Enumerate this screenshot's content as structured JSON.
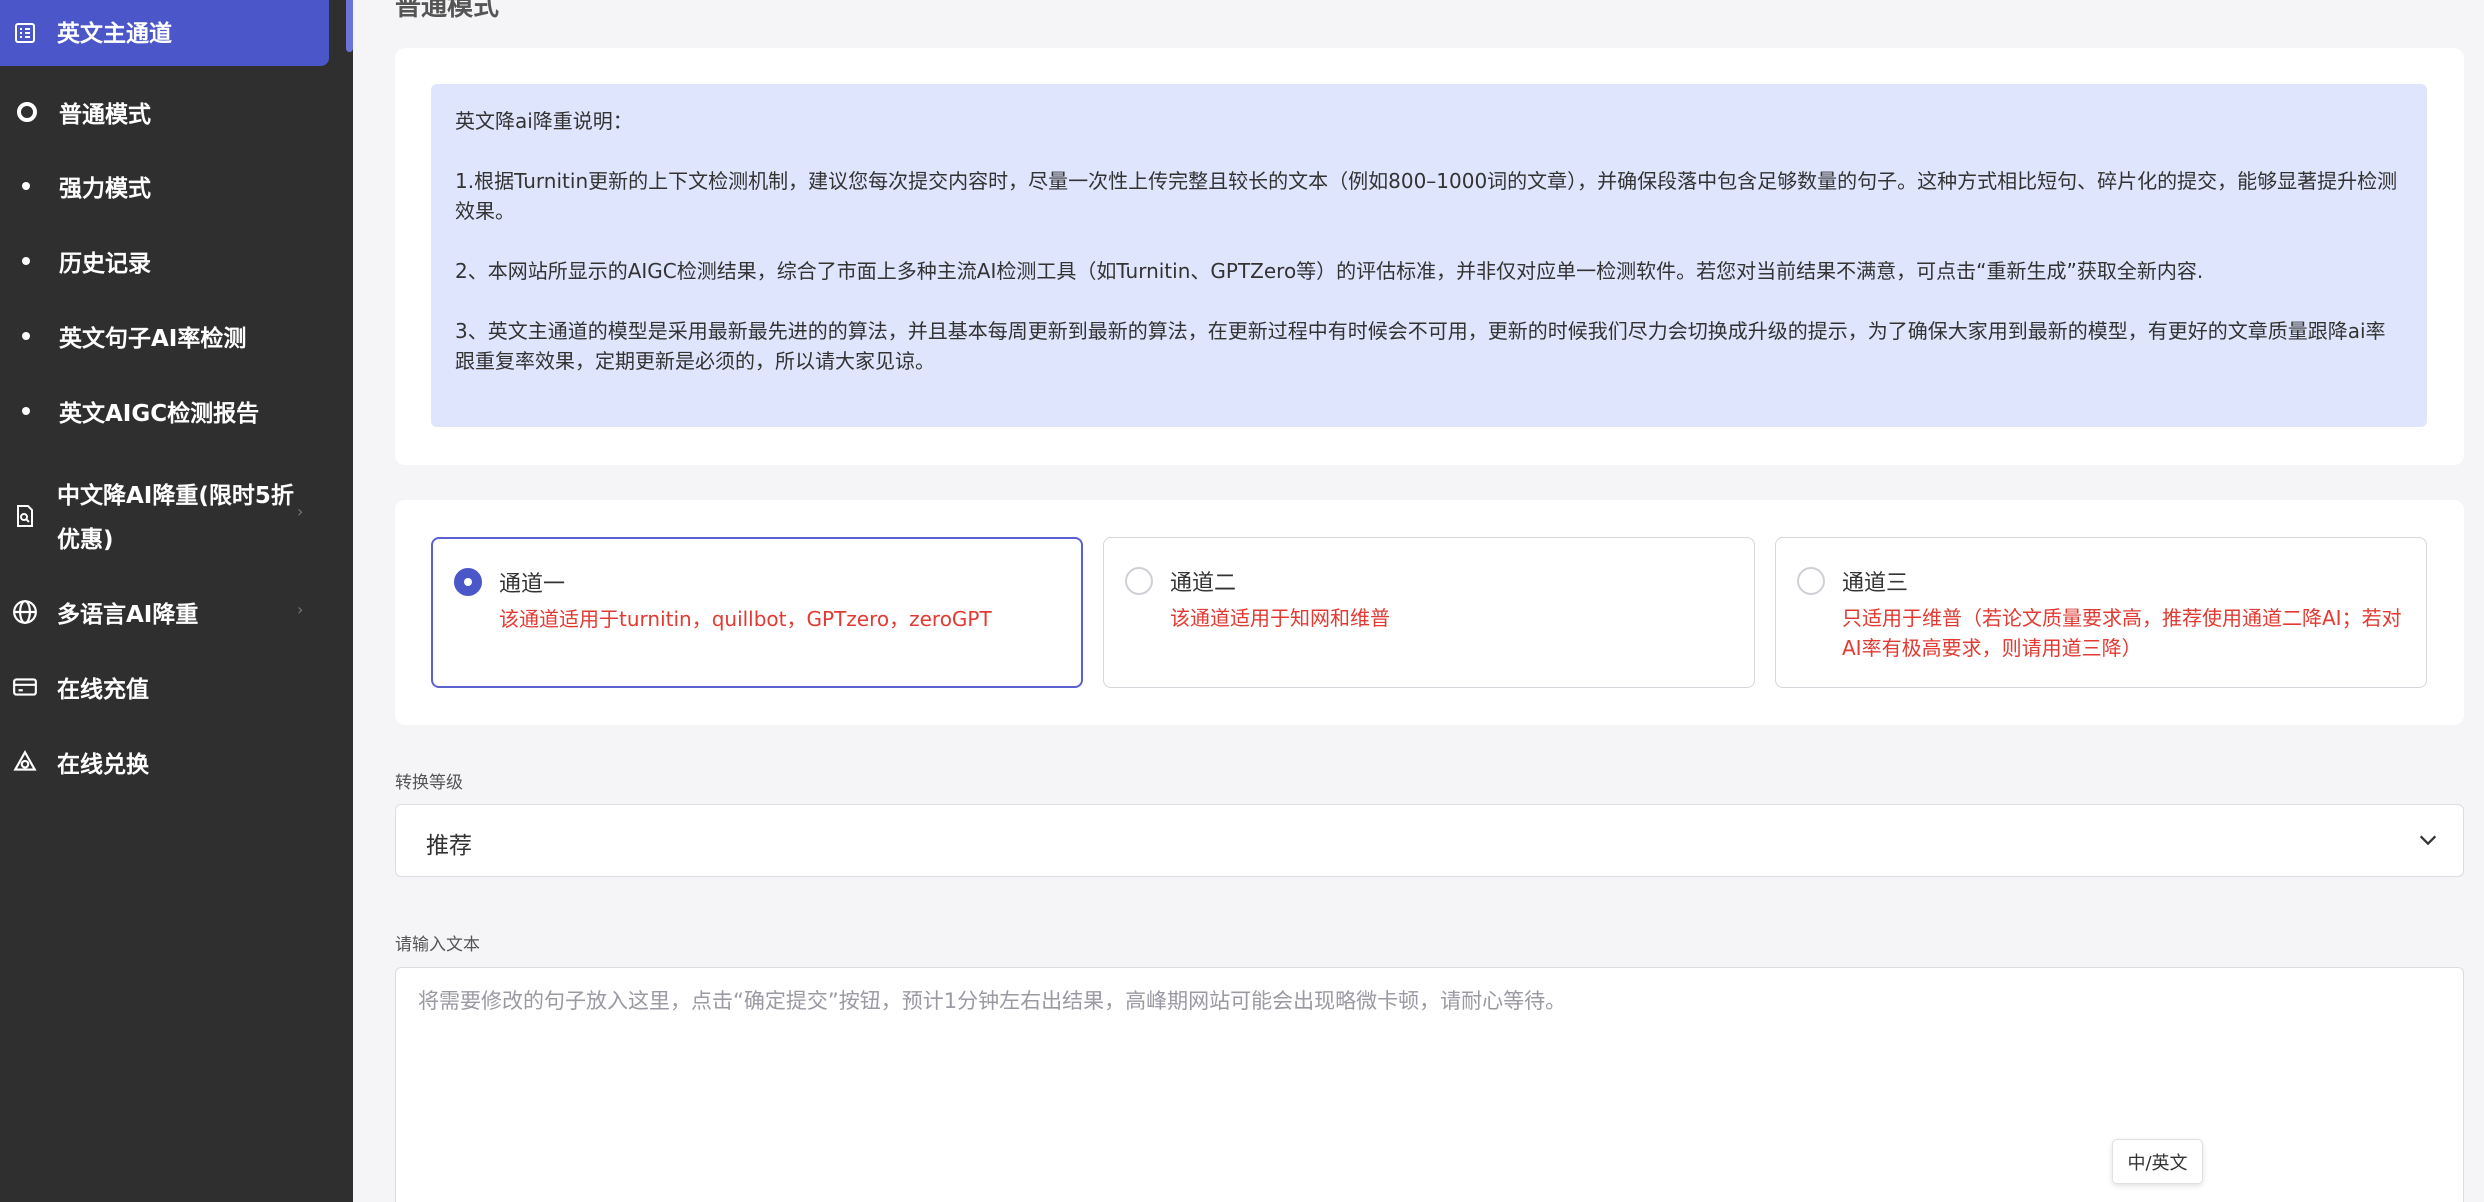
{
  "sidebar": {
    "active_item": {
      "label": "英文主通道",
      "icon": "document-list-icon"
    },
    "sub_items": [
      {
        "label": "普通模式",
        "icon": "ring-icon",
        "selected": true
      },
      {
        "label": "强力模式",
        "icon": "dot-icon"
      },
      {
        "label": "历史记录",
        "icon": "dot-icon"
      },
      {
        "label": "英文句子AI率检测",
        "icon": "dot-icon"
      },
      {
        "label": "英文AIGC检测报告",
        "icon": "dot-icon"
      }
    ],
    "items": [
      {
        "label_line1": "中文降AI降重(限时5折",
        "label_line2": "优惠)",
        "icon": "doc-search-icon",
        "has_chevron": true
      },
      {
        "label": "多语言AI降重",
        "icon": "globe-icon",
        "has_chevron": true
      },
      {
        "label": "在线充值",
        "icon": "card-icon"
      },
      {
        "label": "在线兑换",
        "icon": "exchange-icon"
      }
    ]
  },
  "page_title": "普通模式",
  "notice": {
    "heading": "英文降ai降重说明：",
    "para1": "1.根据Turnitin更新的上下文检测机制，建议您每次提交内容时，尽量一次性上传完整且较长的文本（例如800–1000词的文章），并确保段落中包含足够数量的句子。这种方式相比短句、碎片化的提交，能够显著提升检测效果。",
    "para2": "2、本网站所显示的AIGC检测结果，综合了市面上多种主流AI检测工具（如Turnitin、GPTZero等）的评估标准，并非仅对应单一检测软件。若您对当前结果不满意，可点击“重新生成”获取全新内容.",
    "para3": "3、英文主通道的模型是采用最新最先进的的算法，并且基本每周更新到最新的算法，在更新过程中有时候会不可用，更新的时候我们尽力会切换成升级的提示，为了确保大家用到最新的模型，有更好的文章质量跟降ai率跟重复率效果，定期更新是必须的，所以请大家见谅。"
  },
  "channels": [
    {
      "title": "通道一",
      "desc": "该通道适用于turnitin，quillbot，GPTzero，zeroGPT",
      "selected": true
    },
    {
      "title": "通道二",
      "desc": "该通道适用于知网和维普",
      "selected": false
    },
    {
      "title": "通道三",
      "desc": "只适用于维普（若论文质量要求高，推荐使用通道二降AI；若对AI率有极高要求，则请用道三降）",
      "selected": false
    }
  ],
  "level": {
    "label": "转换等级",
    "value": "推荐"
  },
  "input": {
    "label": "请输入文本",
    "placeholder": "将需要修改的句子放入这里，点击“确定提交”按钮，预计1分钟左右出结果，高峰期网站可能会出现略微卡顿，请耐心等待。",
    "lang_toggle": "中/英文"
  },
  "colors": {
    "sidebar_bg": "#2f2f2f",
    "active_bg": "#4b56c9",
    "notice_bg": "#dfe5fc",
    "warning_text": "#e23a32"
  }
}
